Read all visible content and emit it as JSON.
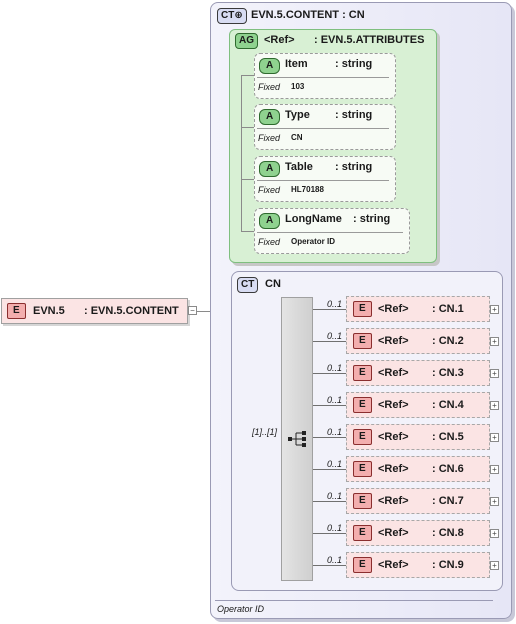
{
  "root": {
    "badge": "E",
    "name": "EVN.5",
    "type": ": EVN.5.CONTENT"
  },
  "complex_type": {
    "badge": "CT",
    "title": "EVN.5.CONTENT : CN",
    "footer": "Operator ID"
  },
  "attribute_group": {
    "badge": "AG",
    "ref": "<Ref>",
    "name": ": EVN.5.ATTRIBUTES",
    "attributes": [
      {
        "badge": "A",
        "name": "Item",
        "type": ": string",
        "fixed_label": "Fixed",
        "fixed_value": "103"
      },
      {
        "badge": "A",
        "name": "Type",
        "type": ": string",
        "fixed_label": "Fixed",
        "fixed_value": "CN"
      },
      {
        "badge": "A",
        "name": "Table",
        "type": ": string",
        "fixed_label": "Fixed",
        "fixed_value": "HL70188"
      },
      {
        "badge": "A",
        "name": "LongName",
        "type": ": string",
        "fixed_label": "Fixed",
        "fixed_value": "Operator ID"
      }
    ]
  },
  "cn_type": {
    "badge": "CT",
    "title": "CN",
    "sequence_cardinality": "[1]..[1]",
    "elements": [
      {
        "badge": "E",
        "ref": "<Ref>",
        "name": ": CN.1",
        "cardinality": "0..1"
      },
      {
        "badge": "E",
        "ref": "<Ref>",
        "name": ": CN.2",
        "cardinality": "0..1"
      },
      {
        "badge": "E",
        "ref": "<Ref>",
        "name": ": CN.3",
        "cardinality": "0..1"
      },
      {
        "badge": "E",
        "ref": "<Ref>",
        "name": ": CN.4",
        "cardinality": "0..1"
      },
      {
        "badge": "E",
        "ref": "<Ref>",
        "name": ": CN.5",
        "cardinality": "0..1"
      },
      {
        "badge": "E",
        "ref": "<Ref>",
        "name": ": CN.6",
        "cardinality": "0..1"
      },
      {
        "badge": "E",
        "ref": "<Ref>",
        "name": ": CN.7",
        "cardinality": "0..1"
      },
      {
        "badge": "E",
        "ref": "<Ref>",
        "name": ": CN.8",
        "cardinality": "0..1"
      },
      {
        "badge": "E",
        "ref": "<Ref>",
        "name": ": CN.9",
        "cardinality": "0..1"
      }
    ]
  },
  "icons": {
    "collapse": "minus-icon",
    "expand": "plus-icon",
    "sequence": "sequence-icon"
  },
  "colors": {
    "element_fill": "#fbe4e4",
    "attribute_fill": "#d8f0d4",
    "type_fill": "#e6e6f6"
  }
}
